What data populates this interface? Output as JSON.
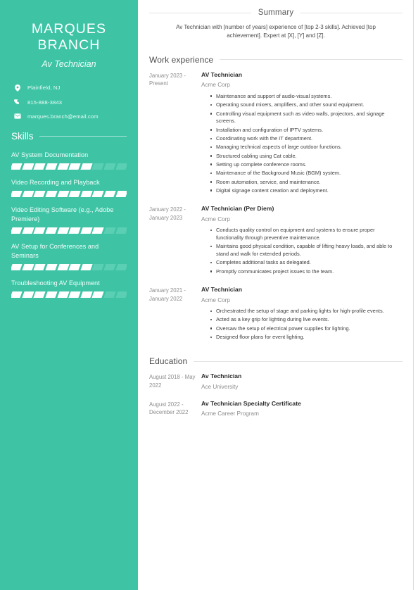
{
  "accent_color": "#3ec4a5",
  "sidebar": {
    "name": "MARQUES BRANCH",
    "job_title": "Av Technician",
    "contacts": [
      {
        "icon": "location-pin-icon",
        "text": "Plainfield, NJ"
      },
      {
        "icon": "phone-icon",
        "text": "815-888-3843"
      },
      {
        "icon": "envelope-icon",
        "text": "marques.branch@email.com"
      }
    ],
    "skills_heading": "Skills",
    "skills": [
      {
        "label": "AV System Documentation",
        "filled": 7,
        "total": 10
      },
      {
        "label": "Video Recording and Playback",
        "filled": 10,
        "total": 10
      },
      {
        "label": "Video Editing Software (e.g., Adobe Premiere)",
        "filled": 8,
        "total": 10
      },
      {
        "label": "AV Setup for Conferences and Seminars",
        "filled": 7,
        "total": 10
      },
      {
        "label": "Troubleshooting AV Equipment",
        "filled": 8,
        "total": 10
      }
    ]
  },
  "main": {
    "summary": {
      "heading": "Summary",
      "text": "Av Technician with [number of years] experience of [top 2-3 skills]. Achieved [top achievement]. Expert at [X], [Y] and [Z]."
    },
    "work_experience": {
      "heading": "Work experience",
      "entries": [
        {
          "dates": "January 2023 - Present",
          "role": "AV Technician",
          "org": "Acme Corp",
          "bullets": [
            "Maintenance and support of audio-visual systems.",
            "Operating sound mixers, amplifiers, and other sound equipment.",
            "Controlling visual equipment such as video walls, projectors, and signage screens.",
            "Installation and configuration of IPTV systems.",
            "Coordinating work with the IT department.",
            "Managing technical aspects of large outdoor functions.",
            "Structured cabling using Cat cable.",
            "Setting up complete conference rooms.",
            "Maintenance of the Background Music (BGM) system.",
            "Room automation, service, and maintenance.",
            "Digital signage content creation and deployment."
          ]
        },
        {
          "dates": "January 2022 - January 2023",
          "role": "AV Technician (Per Diem)",
          "org": "Acme Corp",
          "bullets": [
            "Conducts quality control on equipment and systems to ensure proper functionality through preventive maintenance.",
            "Maintains good physical condition, capable of lifting heavy loads, and able to stand and walk for extended periods.",
            "Completes additional tasks as delegated.",
            "Promptly communicates project issues to the team."
          ]
        },
        {
          "dates": "January 2021 - January 2022",
          "role": "AV Technician",
          "org": "Acme Corp",
          "bullets": [
            "Orchestrated the setup of stage and parking lights for high-profile events.",
            "Acted as a key grip for lighting during live events.",
            "Oversaw the setup of electrical power supplies for lighting.",
            "Designed floor plans for event lighting."
          ]
        }
      ]
    },
    "education": {
      "heading": "Education",
      "entries": [
        {
          "dates": "August 2018 - May 2022",
          "role": "Av Technician",
          "org": "Ace University"
        },
        {
          "dates": "August 2022 - December 2022",
          "role": "Av Technician Specialty Certificate",
          "org": "Acme Career Program"
        }
      ]
    }
  }
}
